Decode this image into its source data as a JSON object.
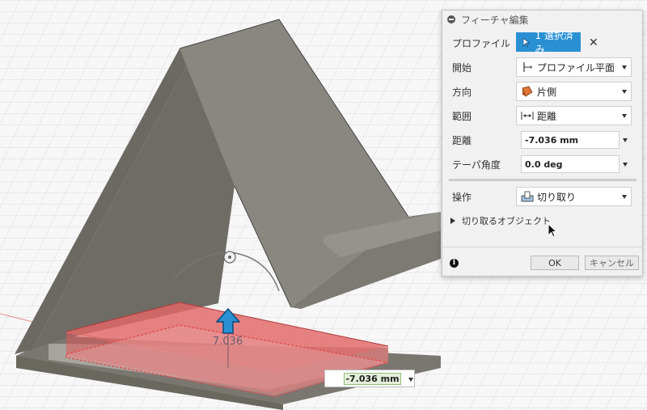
{
  "dialog": {
    "title": "フィーチャ編集",
    "profile": {
      "label": "プロファイル",
      "selection": "1 選択済み"
    },
    "start": {
      "label": "開始",
      "value": "プロファイル平面"
    },
    "direction": {
      "label": "方向",
      "value": "片側"
    },
    "extent": {
      "label": "範囲",
      "value": "距離"
    },
    "distance": {
      "label": "距離",
      "value": "-7.036 mm"
    },
    "taper": {
      "label": "テーパ角度",
      "value": "0.0 deg"
    },
    "operation": {
      "label": "操作",
      "value": "切り取り"
    },
    "objects_to_cut": "切り取るオブジェクト",
    "ok_label": "OK",
    "cancel_label": "キャンセル"
  },
  "canvas": {
    "dimension_value": "-7.036 mm",
    "dimension_text": "7.036"
  },
  "colors": {
    "accent": "#2a90d4",
    "cut_highlight": "#e05050",
    "body": "#8a8780"
  }
}
